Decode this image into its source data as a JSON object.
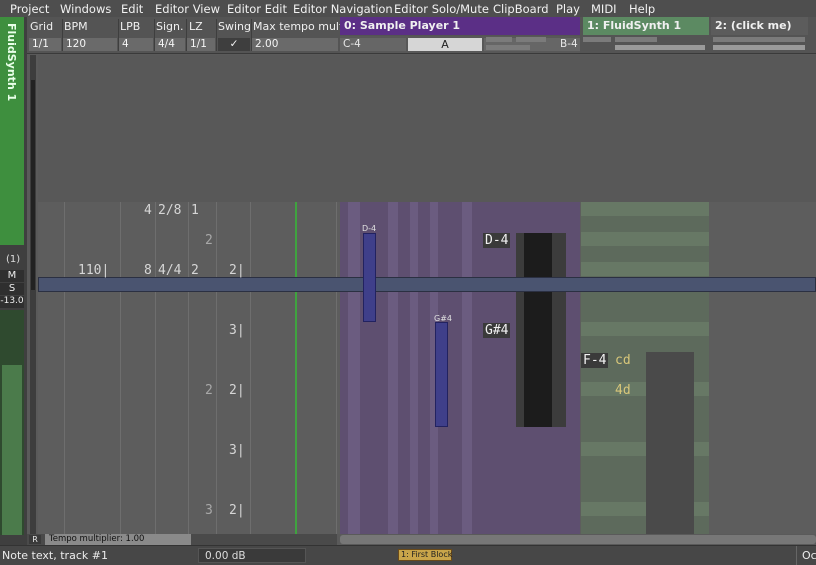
{
  "menu": [
    "Project",
    "Windows",
    "Edit",
    "Editor View",
    "Editor Edit",
    "Editor Navigation",
    "Editor Solo/Mute",
    "ClipBoard",
    "Play",
    "MIDI",
    "Help"
  ],
  "toolbar": {
    "grid_label": "Grid",
    "grid_value": "1/1",
    "bpm_label": "BPM",
    "bpm_value": "120",
    "lpb_label": "LPB",
    "lpb_value": "4",
    "sign_label": "Sign.",
    "sign_value": "4/4",
    "lz_label": "LZ",
    "lz_value": "1/1",
    "swing_label": "Swing",
    "swing_value": "✓",
    "max_tempo_label": "Max tempo multi",
    "max_tempo_value": "2.00"
  },
  "instruments": [
    {
      "header": "0:   Sample Player 1",
      "low": "C-4",
      "mid": "A",
      "high": "B-4"
    },
    {
      "header": "1:   FluidSynth 1"
    },
    {
      "header": "2:   (click me)"
    }
  ],
  "side": {
    "track_name": "FluidSynth 1",
    "paren": "(1)",
    "m": "M",
    "s": "S",
    "volume": "-13.0"
  },
  "editor": {
    "bpm_col": "110|",
    "lpb_vals": [
      "4",
      "8"
    ],
    "sign_vals": [
      "2/8",
      "4/4"
    ],
    "lz_vals": [
      "1",
      "2"
    ],
    "bar_vals": [
      "2",
      "2|",
      "3|",
      "2",
      "2|",
      "3|",
      "3",
      "2|"
    ],
    "notes": [
      {
        "label": "D-4",
        "small": "D-4"
      },
      {
        "label": "G#4",
        "small": "G#4"
      },
      {
        "label": "F-4",
        "extra": "cd"
      },
      {
        "extra2": "4d"
      }
    ]
  },
  "bottom": {
    "r": "R",
    "tempo_multiplier": "Tempo multiplier: 1.00",
    "status": "Note text, track #1",
    "db": "0.00 dB",
    "block": "1: First Block",
    "oc": "Oc"
  },
  "colors": {
    "sample_player": "#5b2f86",
    "fluidsynth": "#5c8a62",
    "track_green": "#3e8f3e"
  }
}
